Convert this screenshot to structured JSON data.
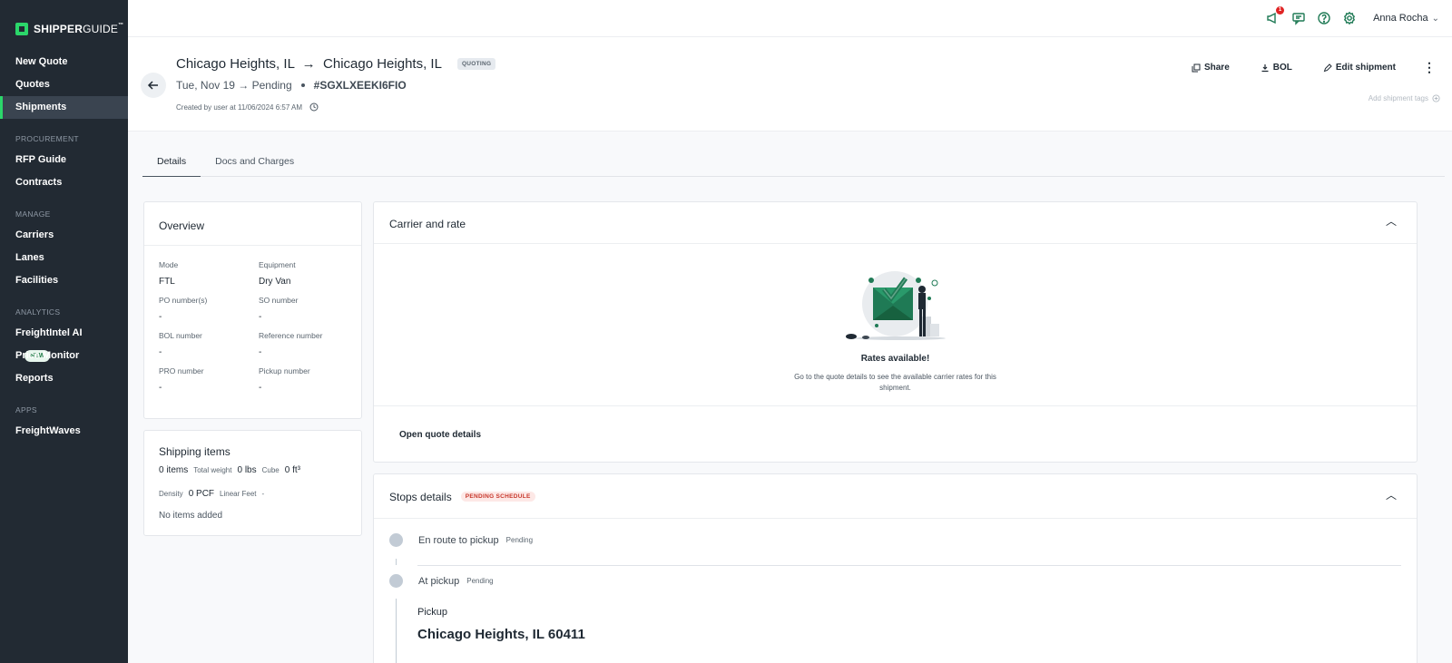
{
  "brand": {
    "strong": "SHIPPER",
    "light": "GUIDE",
    "tm": "™"
  },
  "sidebar": {
    "top_items": [
      {
        "label": "New Quote"
      },
      {
        "label": "Quotes"
      },
      {
        "label": "Shipments"
      }
    ],
    "sections": [
      {
        "title": "PROCUREMENT",
        "items": [
          "RFP Guide",
          "Contracts"
        ]
      },
      {
        "title": "MANAGE",
        "items": [
          "Carriers",
          "Lanes",
          "Facilities"
        ]
      },
      {
        "title": "ANALYTICS",
        "items": [
          "FreightIntel AI",
          "Price Monitor",
          "Reports"
        ],
        "badge": "NEW"
      },
      {
        "title": "APPS",
        "items": [
          "FreightWaves"
        ]
      }
    ]
  },
  "topbar": {
    "notif_count": "1",
    "user_name": "Anna Rocha"
  },
  "header": {
    "route": "Chicago Heights, IL  →  Chicago Heights, IL",
    "status_tag": "QUOTING",
    "date_line": "Tue, Nov 19 → Pending",
    "reference": "#SGXLXEEKI6FIO",
    "created": "Created by user at 11/06/2024 6:57 AM",
    "share": "Share",
    "bol": "BOL",
    "edit": "Edit shipment",
    "tags_link": "Add shipment tags"
  },
  "tabs": [
    "Details",
    "Docs and Charges"
  ],
  "overview": {
    "title": "Overview",
    "fields": [
      {
        "label": "Mode",
        "value": "FTL"
      },
      {
        "label": "Equipment",
        "value": "Dry Van"
      },
      {
        "label": "PO number(s)",
        "value": "-"
      },
      {
        "label": "SO number",
        "value": "-"
      },
      {
        "label": "BOL number",
        "value": "-"
      },
      {
        "label": "Reference number",
        "value": "-"
      },
      {
        "label": "PRO number",
        "value": "-"
      },
      {
        "label": "Pickup number",
        "value": "-"
      }
    ]
  },
  "shipping": {
    "title": "Shipping items",
    "items": "0 items",
    "weight_label": "Total weight",
    "weight": "0 lbs",
    "cube_label": "Cube",
    "cube": "0 ft³",
    "density_label": "Density",
    "density": "0 PCF",
    "linear_label": "Linear Feet",
    "linear": "-",
    "empty": "No items added"
  },
  "carrier": {
    "title": "Carrier and rate",
    "rates_title": "Rates available!",
    "rates_desc": "Go to the quote details to see the available carrier rates for this shipment.",
    "open_quote": "Open quote details"
  },
  "stops": {
    "title": "Stops details",
    "badge": "PENDING SCHEDULE",
    "rows": [
      {
        "label": "En route to pickup",
        "status": "Pending"
      },
      {
        "label": "At pickup",
        "status": "Pending"
      }
    ],
    "pickup_label": "Pickup",
    "pickup_city": "Chicago Heights, IL 60411"
  },
  "colors": {
    "accent": "#2bd66a",
    "sidebar_bg": "#222a33",
    "brand_green": "#1f7a55"
  }
}
